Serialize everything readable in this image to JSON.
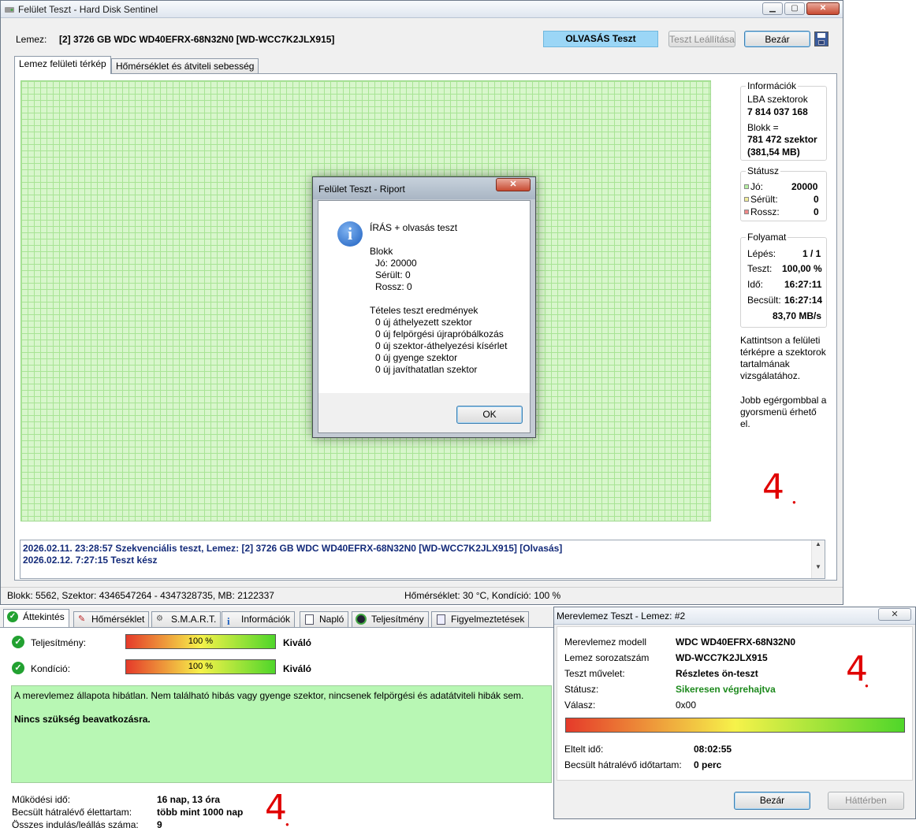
{
  "main_window": {
    "title": "Felület Teszt - Hard Disk Sentinel",
    "disk_label": "Lemez:",
    "disk_value": "[2] 3726 GB  WDC WD40EFRX-68N32N0 [WD-WCC7K2JLX915]",
    "mode_badge": "OLVASÁS Teszt",
    "stop_button": "Teszt Leállítása",
    "close_button": "Bezár",
    "tabs": [
      "Lemez felületi térkép",
      "Hőmérséklet és átviteli sebesség"
    ],
    "info": {
      "title": "Információk",
      "lba_label": "LBA szektorok",
      "lba_value": "7 814 037 168",
      "block_label": "Blokk =",
      "block_value": "781 472 szektor",
      "block_size": "(381,54 MB)"
    },
    "status": {
      "title": "Státusz",
      "good_label": "Jó:",
      "good_value": "20000",
      "damaged_label": "Sérült:",
      "damaged_value": "0",
      "bad_label": "Rossz:",
      "bad_value": "0"
    },
    "progress": {
      "title": "Folyamat",
      "step_label": "Lépés:",
      "step_value": "1 / 1",
      "test_label": "Teszt:",
      "test_value": "100,00 %",
      "time_label": "Idő:",
      "time_value": "16:27:11",
      "est_label": "Becsült:",
      "est_value": "16:27:14",
      "speed": "83,70 MB/s"
    },
    "hint1": [
      "Kattintson a felületi",
      "térképre a szektorok",
      "tartalmának",
      "vizsgálatához."
    ],
    "hint2": [
      "Jobb egérgombbal a",
      "gyorsmenü érhető",
      "el."
    ],
    "log": [
      "2026.02.11.  23:28:57   Szekvenciális teszt, Lemez: [2] 3726 GB  WDC WD40EFRX-68N32N0 [WD-WCC7K2JLX915] [Olvasás]",
      "2026.02.12.  7:27:15   Teszt kész"
    ],
    "statusbar_left": "Blokk: 5562, Szektor: 4346547264 - 4347328735, MB: 2122337",
    "statusbar_right": "Hőmérséklet: 30  °C,  Kondíció: 100 %"
  },
  "report_dialog": {
    "title": "Felület Teszt - Riport",
    "heading": "ÍRÁS + olvasás teszt",
    "block_title": "Blokk",
    "block_lines": [
      "Jó: 20000",
      "Sérült: 0",
      "Rossz: 0"
    ],
    "results_title": "Tételes teszt eredmények",
    "result_lines": [
      "0 új áthelyezett szektor",
      "0 új felpörgési újrapróbálkozás",
      "0 új szektor-áthelyezési kísérlet",
      "0 új gyenge szektor",
      "0 új javíthatatlan szektor"
    ],
    "ok_button": "OK"
  },
  "bottom_panel": {
    "tabs": [
      "Áttekintés",
      "Hőmérséklet",
      "S.M.A.R.T.",
      "Információk",
      "Napló",
      "Teljesítmény",
      "Figyelmeztetések"
    ],
    "performance_label": "Teljesítmény:",
    "performance_pct": "100 %",
    "performance_value": 100,
    "performance_rating": "Kiváló",
    "health_label": "Kondíció:",
    "health_pct": "100 %",
    "health_value": 100,
    "health_rating": "Kiváló",
    "message": "A merevlemez állapota hibátlan. Nem található hibás vagy gyenge szektor, nincsenek felpörgési és adatátviteli hibák sem.",
    "message_bold": "Nincs szükség beavatkozásra.",
    "uptime_label": "Működési idő:",
    "uptime_value": "16 nap, 13 óra",
    "remaining_label": "Becsült hátralévő élettartam:",
    "remaining_value": "több mint 1000 nap",
    "starts_label": "Összes indulás/leállás száma:",
    "starts_value": "9"
  },
  "selftest_window": {
    "title": "Merevlemez Teszt - Lemez: #2",
    "model_label": "Merevlemez modell",
    "model_value": "WDC WD40EFRX-68N32N0",
    "serial_label": "Lemez sorozatszám",
    "serial_value": "WD-WCC7K2JLX915",
    "op_label": "Teszt művelet:",
    "op_value": "Részletes ön-teszt",
    "status_label": "Státusz:",
    "status_value": "Sikeresen végrehajtva",
    "reply_label": "Válasz:",
    "reply_value": "0x00",
    "progress_value": 100,
    "elapsed_label": "Eltelt idő:",
    "elapsed_value": "08:02:55",
    "remaining_label": "Becsült hátralévő időtartam:",
    "remaining_value": "0 perc",
    "close_button": "Bezár",
    "background_button": "Háttérben"
  },
  "annotations": [
    "4",
    "4",
    "4"
  ],
  "colors": {
    "good": "#b6f0a4",
    "damaged": "#f3ee9c",
    "bad": "#f08a8a",
    "badge": "#9bd6f6",
    "success": "#1e8a1e"
  }
}
